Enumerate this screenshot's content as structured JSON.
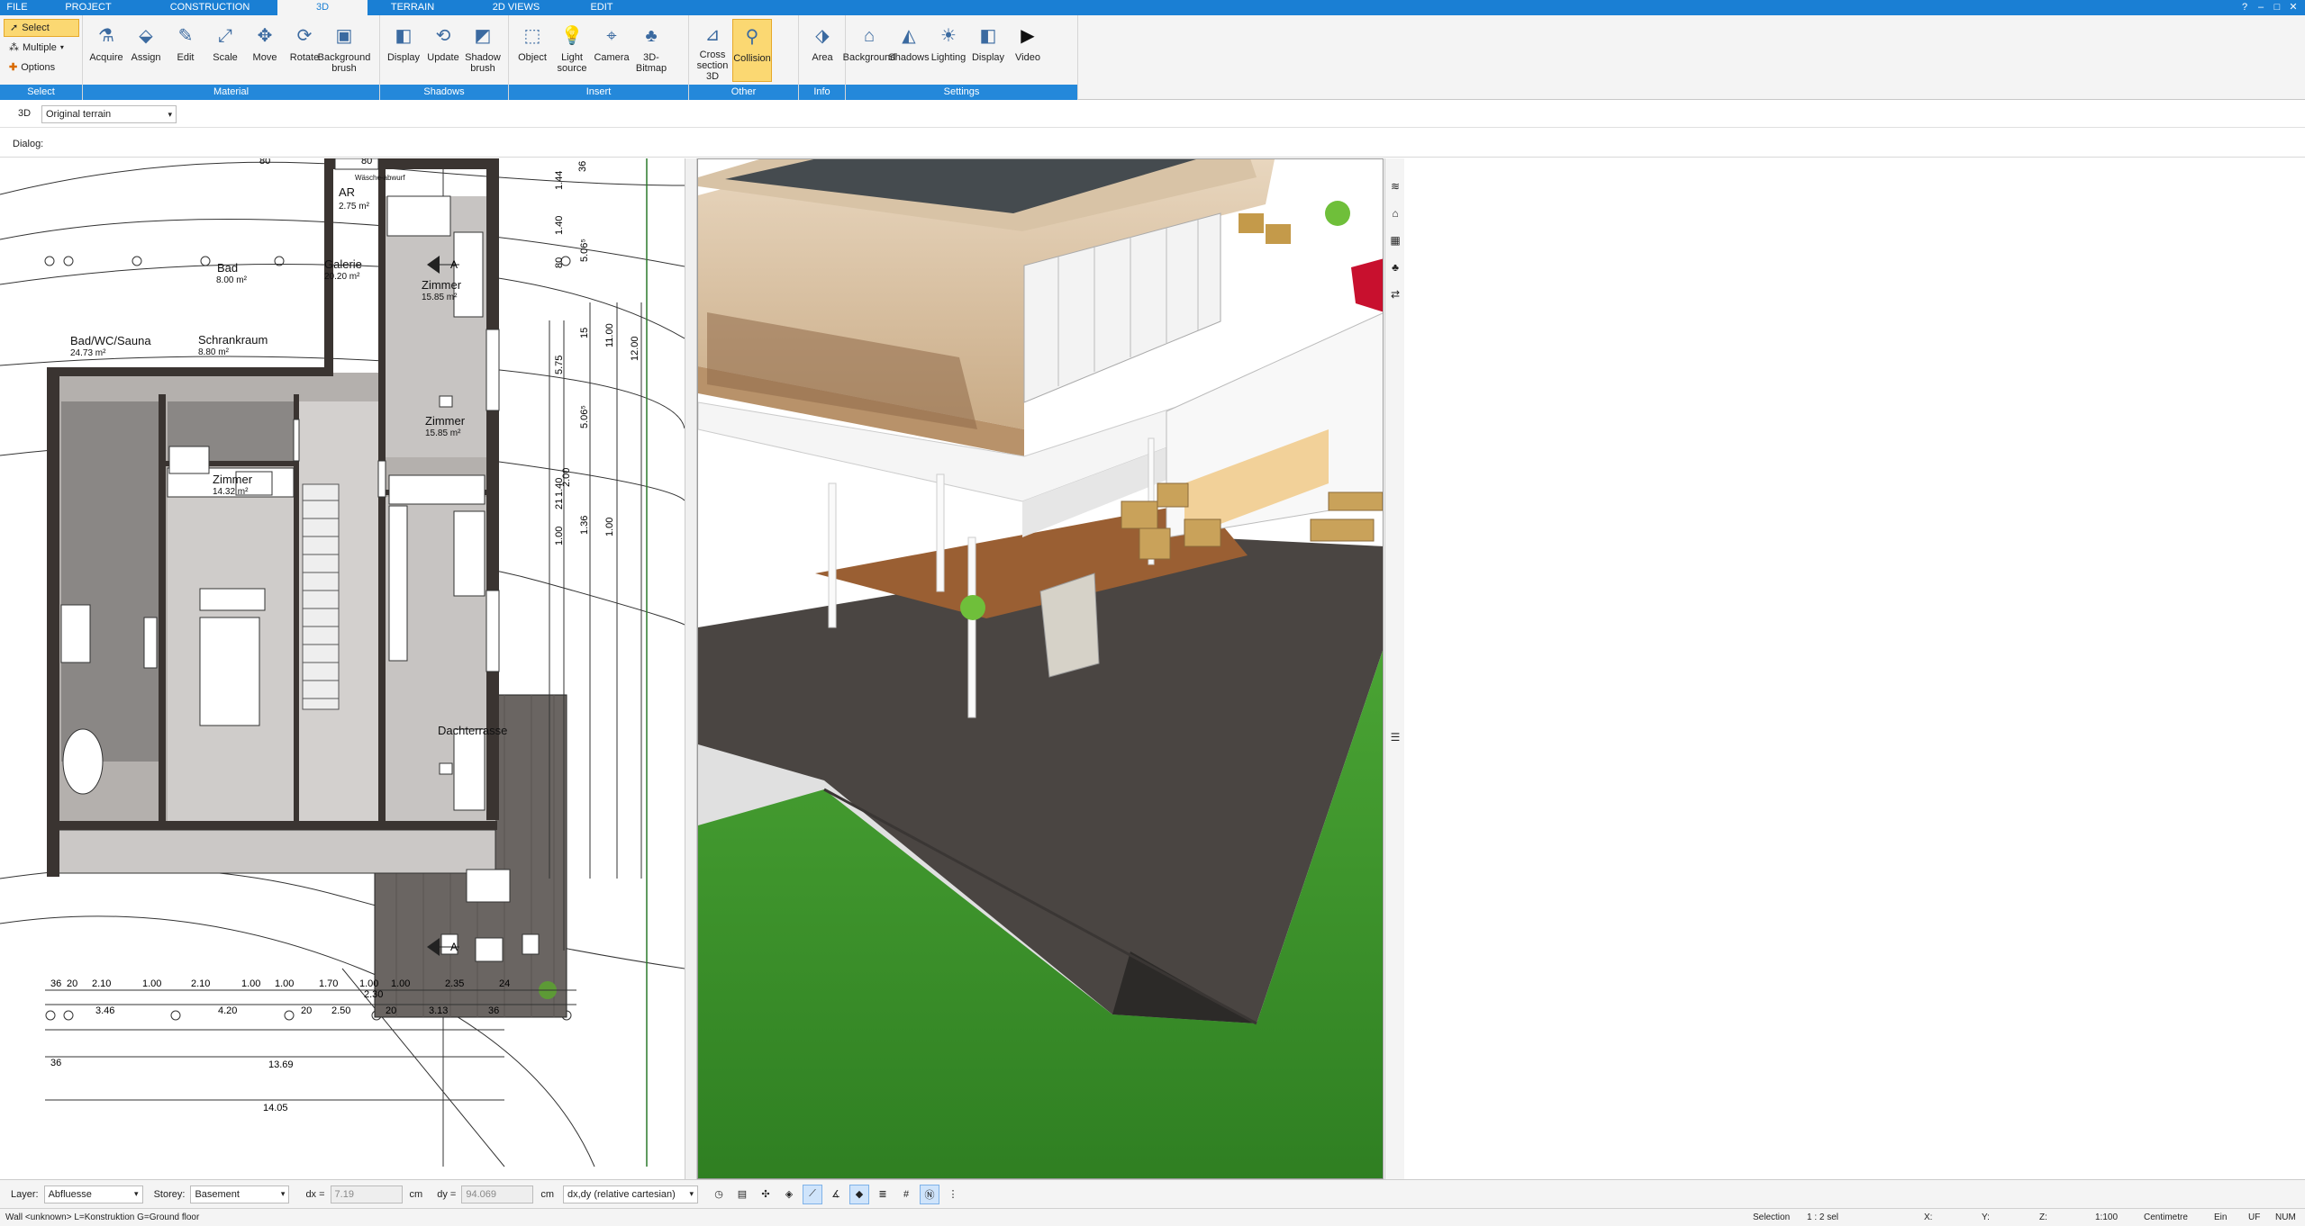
{
  "tabs": [
    {
      "label": "FILE",
      "w": 38
    },
    {
      "label": "PROJECT",
      "w": 120
    },
    {
      "label": "CONSTRUCTION",
      "w": 150
    },
    {
      "label": "3D",
      "w": 100,
      "active": true
    },
    {
      "label": "TERRAIN",
      "w": 100
    },
    {
      "label": "2D VIEWS",
      "w": 130
    },
    {
      "label": "EDIT",
      "w": 60
    }
  ],
  "ribbon": {
    "select": {
      "select_label": "Select",
      "multiple_label": "Multiple",
      "options_label": "Options",
      "group_label": "Select"
    },
    "material": {
      "group_label": "Material",
      "buttons": [
        "Acquire",
        "Assign",
        "Edit",
        "Scale",
        "Move",
        "Rotate",
        "Background brush"
      ]
    },
    "shadows": {
      "group_label": "Shadows",
      "buttons": [
        "Display",
        "Update",
        "Shadow brush"
      ]
    },
    "insert": {
      "group_label": "Insert",
      "buttons": [
        "Object",
        "Light source",
        "Camera",
        "3D-Bitmap"
      ]
    },
    "other": {
      "group_label": "Other",
      "buttons": [
        "Cross section 3D",
        "Collision"
      ]
    },
    "info": {
      "group_label": "Info",
      "buttons": [
        "Area"
      ]
    },
    "settings": {
      "group_label": "Settings",
      "buttons": [
        "Background",
        "Shadows",
        "Lighting",
        "Display",
        "Video"
      ]
    }
  },
  "viewrow": {
    "view_label": "3D",
    "view_select": "Original terrain"
  },
  "dialogrow": {
    "label": "Dialog:"
  },
  "plan": {
    "rooms": [
      {
        "name": "AR",
        "area": "2.75 m²"
      },
      {
        "name": "Bad",
        "area": "8.00 m²"
      },
      {
        "name": "Galerie",
        "area": "20.20 m²"
      },
      {
        "name": "Zimmer",
        "area": "15.85 m²"
      },
      {
        "name": "Bad/WC/Sauna",
        "area": "24.73 m²"
      },
      {
        "name": "Schrankraum",
        "area": "8.80 m²"
      },
      {
        "name": "Zimmer",
        "area": "15.85 m²"
      },
      {
        "name": "Zimmer",
        "area": "14.32 m²"
      },
      {
        "name": "Dachterrasse",
        "area": ""
      }
    ],
    "waesche_label": "Wäsche-abwurf",
    "top_dims": [
      "80",
      "80"
    ],
    "section_mark": "A",
    "dims_row1": [
      "36",
      "20",
      "2.10",
      "1.00",
      "2.10",
      "1.00",
      "1.00",
      "1.70",
      "1.00",
      "1.00",
      "2.35",
      "24"
    ],
    "dim_230": "2.30",
    "dims_row2": [
      "3.46",
      "4.20",
      "20",
      "2.50",
      "20",
      "3.13",
      "36"
    ],
    "dim_36": "36",
    "dim_1369": "13.69",
    "dim_1405": "14.05",
    "vdims": [
      "36",
      "1.44",
      "1.40",
      "80",
      "5.06⁵",
      "15",
      "5.75",
      "11.00",
      "12.00",
      "5.06⁵",
      "1.40",
      "2.00",
      "21",
      "1.00",
      "1.36",
      "1.00"
    ]
  },
  "bottombar": {
    "layer_label": "Layer:",
    "layer_value": "Abfluesse",
    "storey_label": "Storey:",
    "storey_value": "Basement",
    "dx_label": "dx =",
    "dx_value": "7.19",
    "dx_unit": "cm",
    "dy_label": "dy =",
    "dy_value": "94.069",
    "dy_unit": "cm",
    "coord_mode": "dx,dy (relative cartesian)"
  },
  "statusbar": {
    "left": "Wall <unknown> L=Konstruktion G=Ground floor",
    "selection": "Selection",
    "sel_count": "1 : 2 sel",
    "x_label": "X:",
    "y_label": "Y:",
    "z_label": "Z:",
    "scale": "1:100",
    "unit": "Centimetre",
    "ein": "Ein",
    "uf": "UF",
    "num": "NUM"
  },
  "colors": {
    "accent": "#1a7fd4",
    "ribbon_group": "#2488da",
    "active_button": "#fbd872",
    "grass": "#3f9a2c",
    "deck": "#4a4542"
  }
}
